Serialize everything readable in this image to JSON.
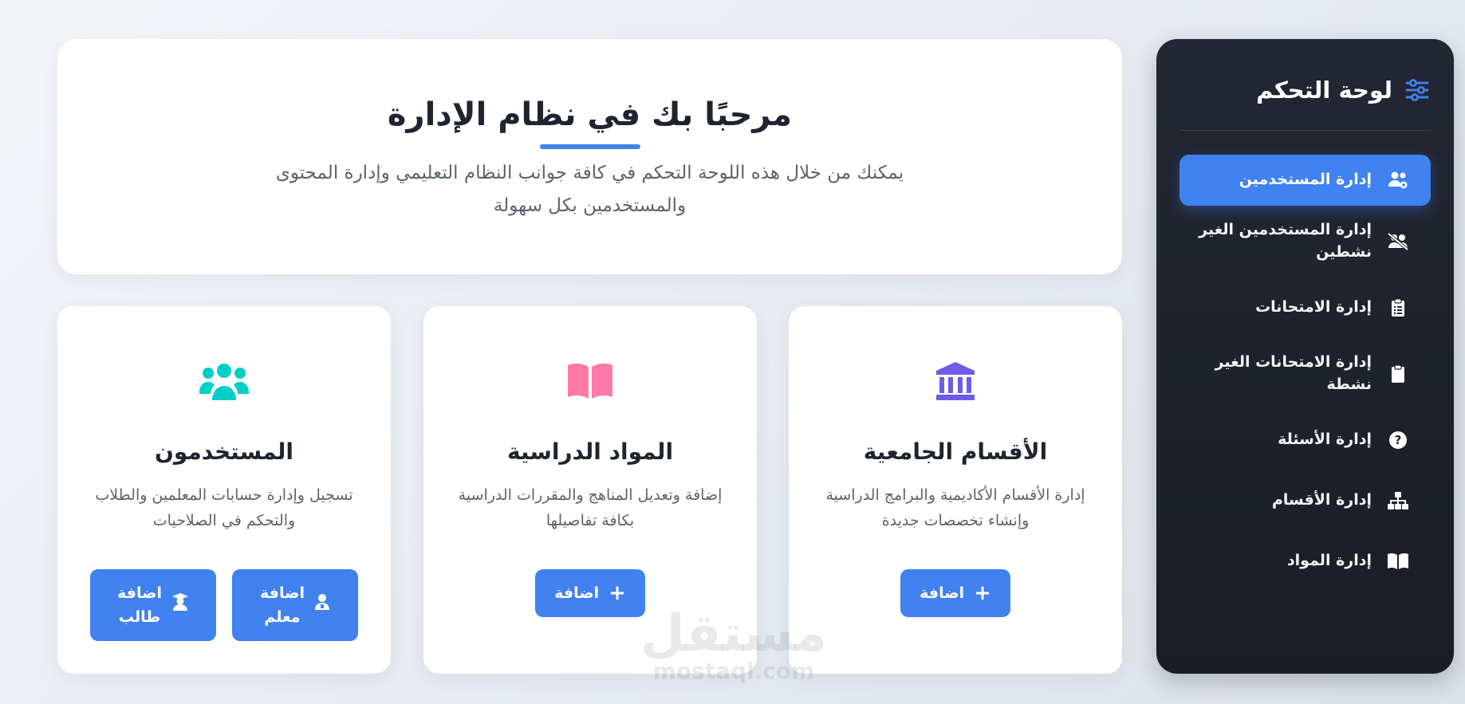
{
  "sidebar": {
    "title": "لوحة التحكم",
    "title_icon": "sliders-icon",
    "items": [
      {
        "label": "إدارة المستخدمين",
        "icon": "users-cog-icon",
        "active": true
      },
      {
        "label": "إدارة المستخدمين الغير نشطين",
        "icon": "users-slash-icon",
        "active": false
      },
      {
        "label": "إدارة الامتحانات",
        "icon": "clipboard-list-icon",
        "active": false
      },
      {
        "label": "إدارة الامتحانات الغير نشطة",
        "icon": "clipboard-icon",
        "active": false
      },
      {
        "label": "إدارة الأسئلة",
        "icon": "question-circle-icon",
        "active": false
      },
      {
        "label": "إدارة الأقسام",
        "icon": "sitemap-icon",
        "active": false
      },
      {
        "label": "إدارة المواد",
        "icon": "book-open-icon",
        "active": false
      }
    ]
  },
  "welcome": {
    "title": "مرحبًا بك في نظام الإدارة",
    "description": "يمكنك من خلال هذه اللوحة التحكم في كافة جوانب النظام التعليمي وإدارة المحتوى والمستخدمين بكل سهولة"
  },
  "cards": {
    "departments": {
      "title": "الأقسام الجامعية",
      "description": "إدارة الأقسام الأكاديمية والبرامج الدراسية وإنشاء تخصصات جديدة",
      "icon": "university-icon",
      "button": "اضافة"
    },
    "subjects": {
      "title": "المواد الدراسية",
      "description": "إضافة وتعديل المناهج والمقررات الدراسية بكافة تفاصيلها",
      "icon": "book-open-icon",
      "button": "اضافة"
    },
    "users": {
      "title": "المستخدمون",
      "description": "تسجيل وإدارة حسابات المعلمين والطلاب والتحكم في الصلاحيات",
      "icon": "users-icon",
      "button_teacher_line1": "اضافة",
      "button_teacher_line2": "معلم",
      "button_student_line1": "اضافة",
      "button_student_line2": "طالب"
    }
  },
  "watermark": {
    "arabic": "مستقل",
    "latin": "mostaql.com"
  },
  "colors": {
    "accent": "#3f82f0",
    "sidebar_bg": "#1f232d",
    "icon_departments": "#6c5ce7",
    "icon_subjects": "#fd79a8",
    "icon_users": "#00cec9"
  }
}
